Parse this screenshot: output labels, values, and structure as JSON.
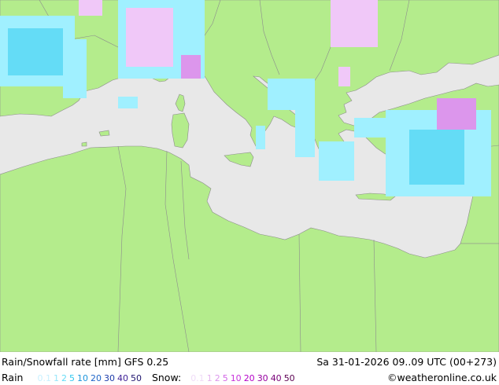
{
  "map": {
    "title": "Rain/Snowfall rate [mm] GFS 0.25",
    "valid_time": "Sa 31-01-2026 09..09 UTC (00+273)",
    "credit": "©weatheronline.co.uk",
    "colors": {
      "sea": "#e8e8e8",
      "land": "#b4ec8c",
      "border": "#8c8c8c",
      "rain_light": "#a0f0ff",
      "rain_medium": "#64dcf6",
      "snow_light": "#f0c8f8",
      "snow_medium": "#dc96ec"
    }
  },
  "legend": {
    "rain_label": "Rain",
    "rain_values": [
      "0.1",
      "1",
      "2",
      "5",
      "10",
      "20",
      "30",
      "40",
      "50"
    ],
    "rain_colors": [
      "#c8f0ff",
      "#96e6fa",
      "#64dcf6",
      "#32c8f0",
      "#1e96dc",
      "#1e64c8",
      "#1e3caa",
      "#3c1e96",
      "#1e146e"
    ],
    "snow_label": "Snow:",
    "snow_values": [
      "0.1",
      "1",
      "2",
      "5",
      "10",
      "20",
      "30",
      "40",
      "50"
    ],
    "snow_colors": [
      "#f0dcf8",
      "#e6b4f0",
      "#dc96ec",
      "#d264e6",
      "#c832dc",
      "#b400c8",
      "#9600a0",
      "#780078",
      "#5a0050"
    ]
  }
}
